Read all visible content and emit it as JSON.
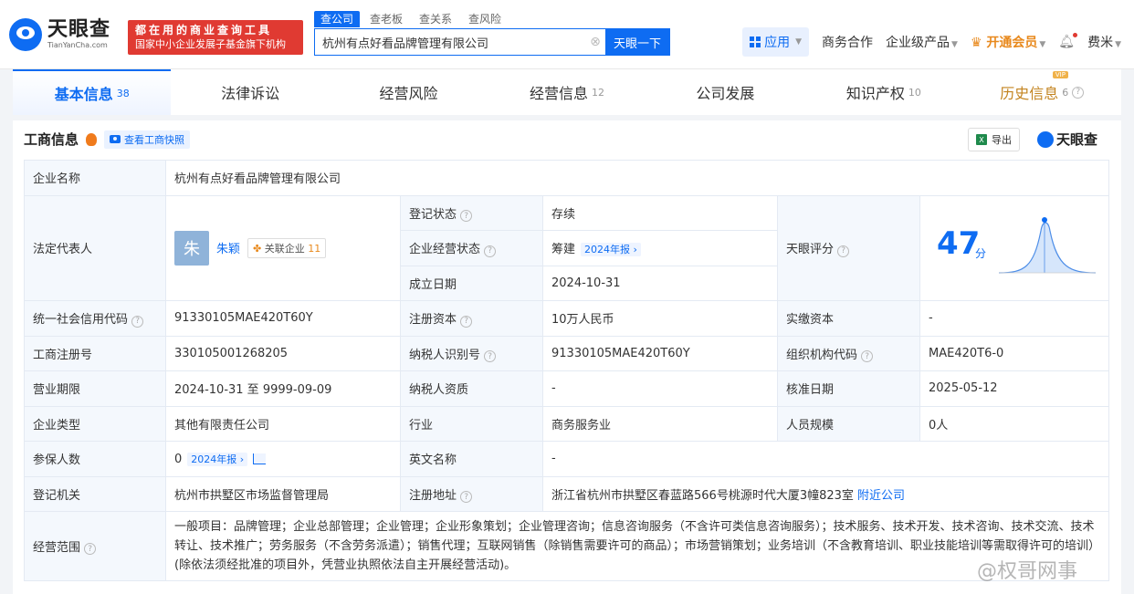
{
  "header": {
    "logo_cn": "天眼查",
    "logo_en": "TianYanCha.com",
    "slogan_line1": "都在用的商业查询工具",
    "slogan_line2": "国家中小企业发展子基金旗下机构",
    "search_tabs": [
      "查公司",
      "查老板",
      "查关系",
      "查风险"
    ],
    "search_value": "杭州有点好看品牌管理有限公司",
    "search_button": "天眼一下",
    "app_label": "应用",
    "biz_coop": "商务合作",
    "enterprise_products": "企业级产品",
    "vip": "开通会员",
    "user": "费米"
  },
  "tabs": [
    {
      "label": "基本信息",
      "count": "38"
    },
    {
      "label": "法律诉讼",
      "count": ""
    },
    {
      "label": "经营风险",
      "count": ""
    },
    {
      "label": "经营信息",
      "count": "12"
    },
    {
      "label": "公司发展",
      "count": ""
    },
    {
      "label": "知识产权",
      "count": "10"
    },
    {
      "label": "历史信息",
      "count": "6"
    }
  ],
  "section": {
    "title": "工商信息",
    "snapshot": "查看工商快照",
    "export": "导出",
    "watermark": "天眼查"
  },
  "info": {
    "company_name_label": "企业名称",
    "company_name": "杭州有点好看品牌管理有限公司",
    "legal_rep_label": "法定代表人",
    "legal_rep_avatar": "朱",
    "legal_rep_name": "朱颖",
    "related_label": "关联企业",
    "related_count": "11",
    "reg_status_label": "登记状态",
    "reg_status": "存续",
    "op_status_label": "企业经营状态",
    "op_status": "筹建",
    "op_status_tag": "2024年报",
    "found_date_label": "成立日期",
    "found_date": "2024-10-31",
    "score_label": "天眼评分",
    "score": "47",
    "score_unit": "分",
    "credit_code_label": "统一社会信用代码",
    "credit_code": "91330105MAE420T60Y",
    "reg_capital_label": "注册资本",
    "reg_capital": "10万人民币",
    "paid_capital_label": "实缴资本",
    "paid_capital": "-",
    "reg_no_label": "工商注册号",
    "reg_no": "330105001268205",
    "taxpayer_id_label": "纳税人识别号",
    "taxpayer_id": "91330105MAE420T60Y",
    "org_code_label": "组织机构代码",
    "org_code": "MAE420T6-0",
    "term_label": "营业期限",
    "term": "2024-10-31 至 9999-09-09",
    "taxpayer_qual_label": "纳税人资质",
    "taxpayer_qual": "-",
    "approve_date_label": "核准日期",
    "approve_date": "2025-05-12",
    "type_label": "企业类型",
    "type": "其他有限责任公司",
    "industry_label": "行业",
    "industry": "商务服务业",
    "staff_label": "人员规模",
    "staff": "0人",
    "insured_label": "参保人数",
    "insured": "0",
    "insured_tag": "2024年报",
    "en_name_label": "英文名称",
    "en_name": "-",
    "reg_auth_label": "登记机关",
    "reg_auth": "杭州市拱墅区市场监督管理局",
    "reg_addr_label": "注册地址",
    "reg_addr": "浙江省杭州市拱墅区春蓝路566号桃源时代大厦3幢823室",
    "nearby": "附近公司",
    "scope_label": "经营范围",
    "scope": "一般项目：品牌管理；企业总部管理；企业管理；企业形象策划；企业管理咨询；信息咨询服务（不含许可类信息咨询服务）；技术服务、技术开发、技术咨询、技术交流、技术转让、技术推广；劳务服务（不含劳务派遣）；销售代理；互联网销售（除销售需要许可的商品）；市场营销策划；业务培训（不含教育培训、职业技能培训等需取得许可的培训）(除依法须经批准的项目外，凭营业执照依法自主开展经营活动)。"
  },
  "watermark_weibo": "@权哥网事",
  "colors": {
    "brand": "#0e6cf2",
    "vip": "#e8891d",
    "status_green": "#18a058",
    "slogan_red": "#e03a32"
  }
}
